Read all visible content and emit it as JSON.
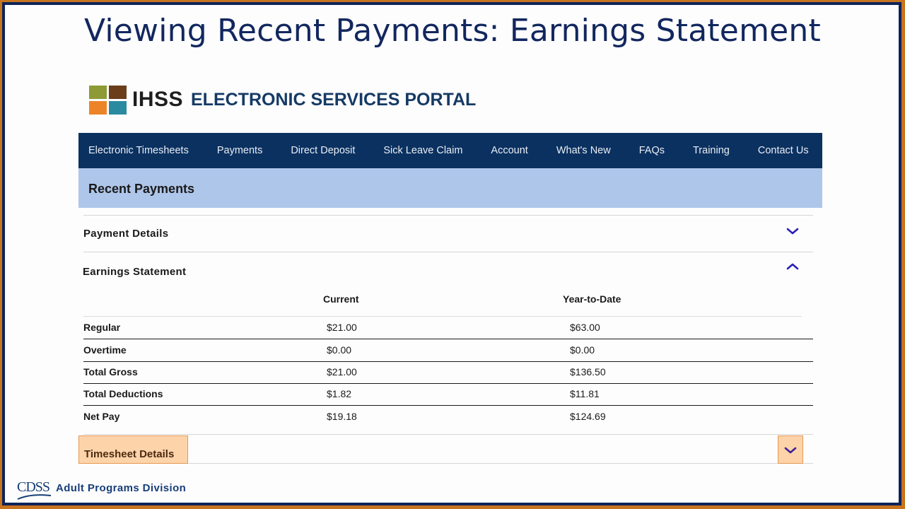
{
  "slide": {
    "title": "Viewing Recent Payments:  Earnings Statement"
  },
  "portal": {
    "logo_text": "IHSS",
    "title": "ELECTRONIC SERVICES PORTAL",
    "logo_colors": [
      "#8e9a36",
      "#6a3e1a",
      "#ec8427",
      "#2a8aa0"
    ]
  },
  "nav": {
    "items": [
      {
        "label": "Electronic Timesheets"
      },
      {
        "label": "Payments"
      },
      {
        "label": "Direct Deposit"
      },
      {
        "label": "Sick Leave Claim"
      },
      {
        "label": "Account"
      },
      {
        "label": "What's New"
      },
      {
        "label": "FAQs"
      },
      {
        "label": "Training"
      },
      {
        "label": "Contact Us"
      }
    ]
  },
  "page": {
    "section_title": "Recent Payments",
    "accordions": {
      "payment_details": {
        "label": "Payment Details",
        "state": "collapsed",
        "icon": "chevron-down-icon"
      },
      "earnings_statement": {
        "label": "Earnings Statement",
        "state": "expanded",
        "icon": "chevron-up-icon"
      },
      "timesheet_details": {
        "label": "Timesheet Details",
        "state": "collapsed",
        "icon": "chevron-down-icon",
        "highlighted": true
      }
    }
  },
  "earnings": {
    "columns": [
      "",
      "Current",
      "Year-to-Date"
    ],
    "rows": [
      {
        "label": "Regular",
        "current": "$21.00",
        "ytd": "$63.00"
      },
      {
        "label": "Overtime",
        "current": "$0.00",
        "ytd": "$0.00"
      },
      {
        "label": "Total Gross",
        "current": "$21.00",
        "ytd": "$136.50"
      },
      {
        "label": "Total Deductions",
        "current": "$1.82",
        "ytd": "$11.81"
      },
      {
        "label": "Net Pay",
        "current": "$19.18",
        "ytd": "$124.69"
      }
    ]
  },
  "footer": {
    "logo_text": "CDSS",
    "division": "Adult Programs Division"
  },
  "colors": {
    "accent_navy": "#0b3160",
    "section_blue": "#aec6ea",
    "highlight_orange": "#fdd3aa",
    "chevron": "#2a1fb8",
    "frame_orange": "#c8741e",
    "frame_navy": "#0e2358"
  }
}
